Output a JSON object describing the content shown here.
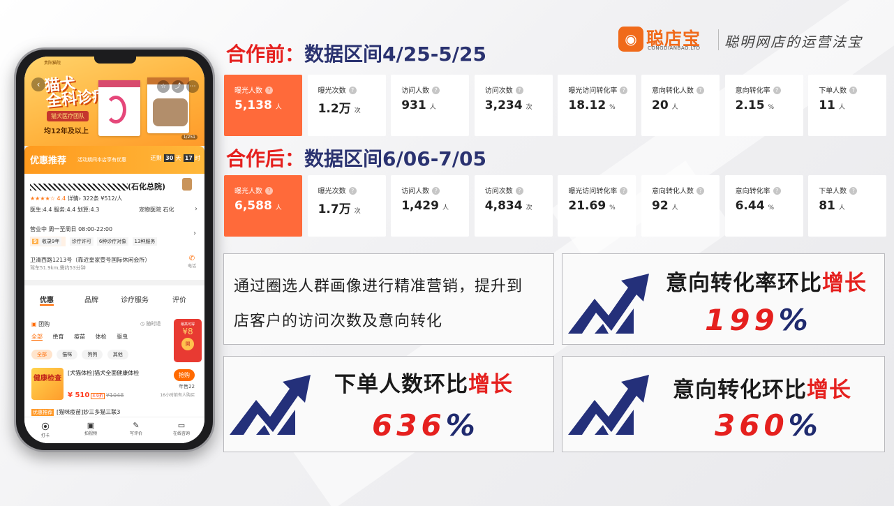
{
  "logo": {
    "mark": "◉",
    "name_cn": "聪店宝",
    "name_en": "CONGDIANBAO.LTD",
    "slogan": "聪明网店的运营法宝"
  },
  "before": {
    "prefix": "合作前：",
    "label": "数据区间4/25-5/25",
    "stats": [
      {
        "label": "曝光人数",
        "value": "5,138",
        "unit": "人",
        "highlight": true
      },
      {
        "label": "曝光次数",
        "value": "1.2万",
        "unit": "次"
      },
      {
        "label": "访问人数",
        "value": "931",
        "unit": "人"
      },
      {
        "label": "访问次数",
        "value": "3,234",
        "unit": "次"
      },
      {
        "label": "曝光访问转化率",
        "value": "18.12",
        "unit": "%"
      },
      {
        "label": "意向转化人数",
        "value": "20",
        "unit": "人"
      },
      {
        "label": "意向转化率",
        "value": "2.15",
        "unit": "%"
      },
      {
        "label": "下单人数",
        "value": "11",
        "unit": "人"
      }
    ]
  },
  "after": {
    "prefix": "合作后：",
    "label": "数据区间6/06-7/05",
    "stats": [
      {
        "label": "曝光人数",
        "value": "6,588",
        "unit": "人",
        "highlight": true
      },
      {
        "label": "曝光次数",
        "value": "1.7万",
        "unit": "次"
      },
      {
        "label": "访问人数",
        "value": "1,429",
        "unit": "人"
      },
      {
        "label": "访问次数",
        "value": "4,834",
        "unit": "次"
      },
      {
        "label": "曝光访问转化率",
        "value": "21.69",
        "unit": "%"
      },
      {
        "label": "意向转化人数",
        "value": "92",
        "unit": "人"
      },
      {
        "label": "意向转化率",
        "value": "6.44",
        "unit": "%"
      },
      {
        "label": "下单人数",
        "value": "81",
        "unit": "人"
      }
    ]
  },
  "summary": {
    "line1": "通过圈选人群画像进行精准营销，提升到",
    "line2": "店客户的访问次数及意向转化"
  },
  "growth": [
    {
      "title": "意向转化率环比",
      "emph": "增长",
      "value": "199",
      "sign": "%"
    },
    {
      "title": "下单人数环比",
      "emph": "增长",
      "value": "636",
      "sign": "%"
    },
    {
      "title": "意向转化环比",
      "emph": "增长",
      "value": "360",
      "sign": "%"
    }
  ],
  "phone": {
    "hero_brand": "贵阳猫院",
    "hero_title_1": "猫犬",
    "hero_title_2": "全科诊疗",
    "hero_pill": "猫犬医疗团队",
    "hero_years": "均12年及以上",
    "hero_counter": "1/251",
    "promo_title": "优惠推荐",
    "promo_sub": "活动期间本店享有优惠",
    "promo_count_label": "还剩",
    "promo_days": "30",
    "promo_day_unit": "天",
    "promo_hours": "17",
    "promo_hour_unit": "时",
    "shop_suffix": "(石化总院)",
    "rating_stars": "★★★★☆",
    "rating_score": "4.4",
    "rating_detail": "详情›",
    "review_count": "322条",
    "avg_price": "¥512/人",
    "sub_scores": "医生:4.4  服务:4.4  划算:4.3",
    "category": "宠物医院  石化",
    "hours": "营业中  周一至周日  08:00-22:00",
    "tag_years_num": "9",
    "tag_years": "收录9年",
    "tags": [
      "诊疗许可",
      "6种诊疗对象",
      "13种服务"
    ],
    "address": "卫清西路1213号（靠近皇家壹号国际休闲会所）",
    "distance": "驾车51.9km,需约53分钟",
    "call_label": "电话",
    "tabs": [
      "优惠",
      "品牌",
      "诊疗服务",
      "评价"
    ],
    "deal_head": "团购",
    "deal_expire": "随时退",
    "deal_cats": [
      "全部",
      "绝育",
      "疫苗",
      "体检",
      "驱虫"
    ],
    "deal_pills": [
      "全部",
      "猫咪",
      "狗狗",
      "其他"
    ],
    "coupon_top": "最高可得",
    "coupon_value": "¥8",
    "coupon_btn": "開",
    "item_pic": "健康检查",
    "item_title": "[犬猫体检]猫犬全面健康体检",
    "item_price": "¥ 510",
    "item_discount": "4.9折",
    "item_orig": "¥1048",
    "item_buy": "抢购",
    "item_sold": "年售22",
    "item_recent": "16小时前有人购买",
    "item2_tag": "优惠推荐",
    "item2_title": "[猫咪疫苗]妙三多猫三联3",
    "nav": [
      {
        "icon": "⦿",
        "label": "打卡"
      },
      {
        "icon": "▣",
        "label": "拍视频"
      },
      {
        "icon": "✎",
        "label": "写评价"
      },
      {
        "icon": "▭",
        "label": "在线咨询"
      }
    ]
  }
}
